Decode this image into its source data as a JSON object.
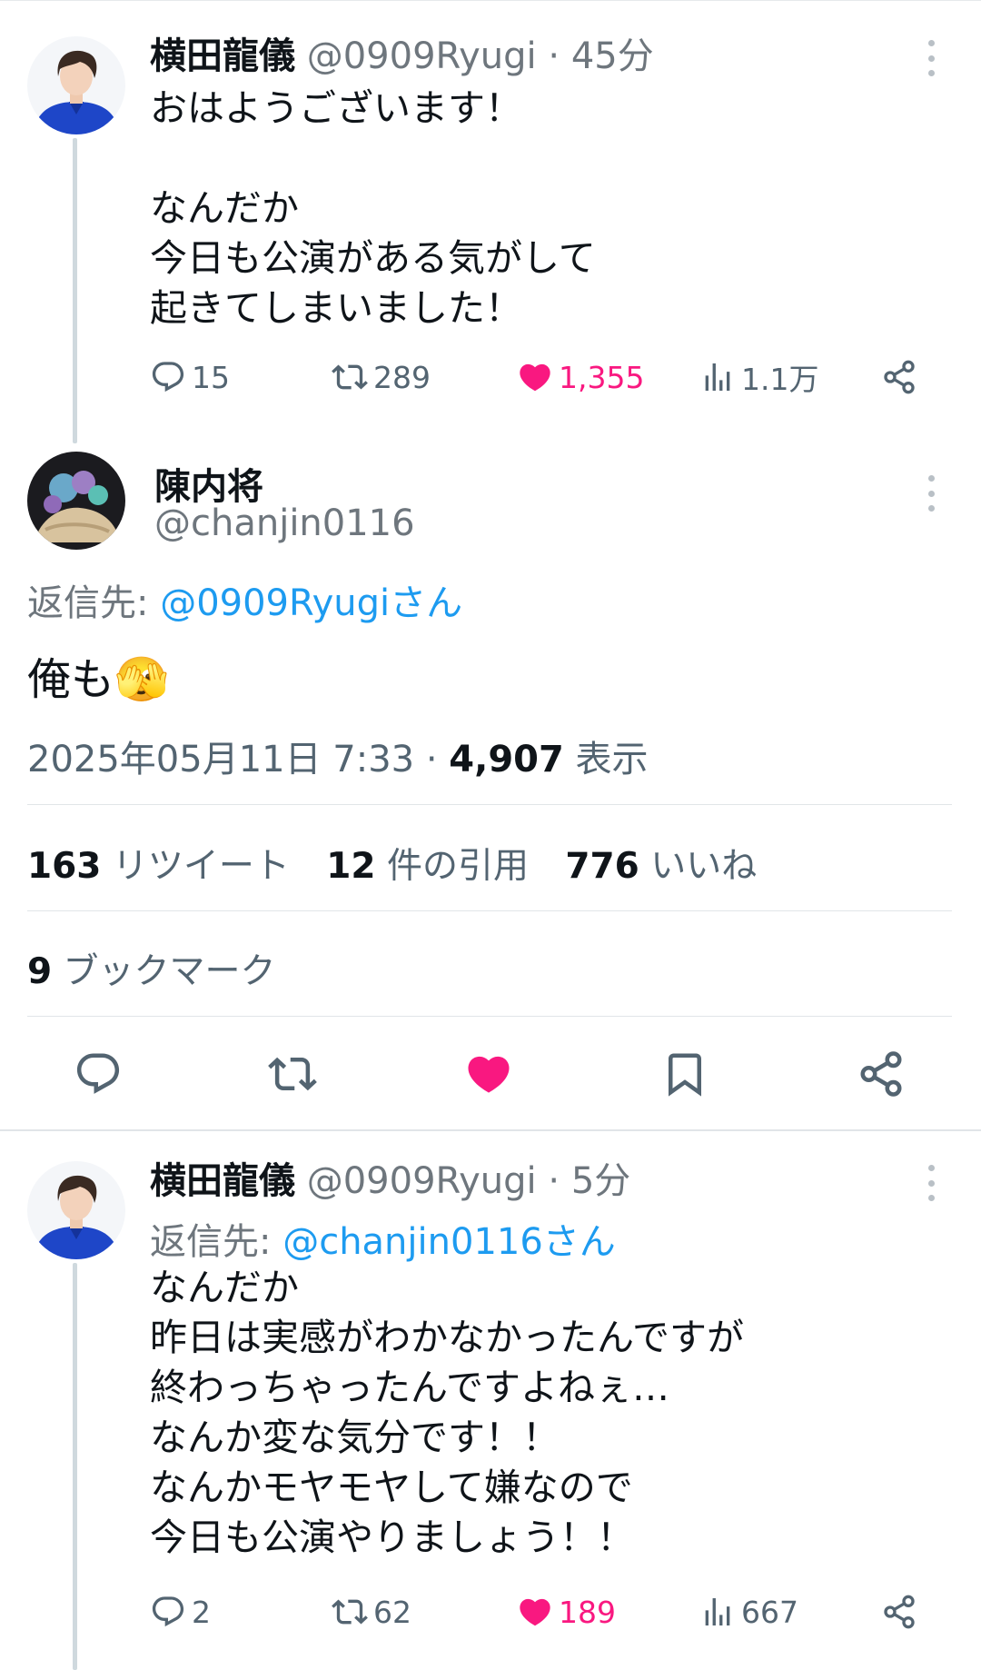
{
  "tweets": [
    {
      "name": "横田龍儀",
      "handle": "@0909Ryugi",
      "time": "45分",
      "lines": [
        "おはようございます！",
        "",
        "なんだか",
        "今日も公演がある気がして",
        "起きてしまいました！"
      ],
      "replies": "15",
      "retweets": "289",
      "likes": "1,355",
      "views": "1.1万"
    },
    {
      "name": "横田龍儀",
      "handle": "@0909Ryugi",
      "time": "5分",
      "reply_to_label": "返信先:",
      "reply_to_user": "@chanjin0116さん",
      "lines": [
        "なんだか",
        "昨日は実感がわかなかったんですが",
        "終わっちゃったんですよねぇ…",
        "なんか変な気分です！！",
        "なんかモヤモヤして嫌なので",
        "今日も公演やりましょう！！"
      ],
      "replies": "2",
      "retweets": "62",
      "likes": "189",
      "views": "667"
    }
  ],
  "main": {
    "name": "陳内将",
    "handle": "@chanjin0116",
    "reply_to_label": "返信先:",
    "reply_to_user": "@0909Ryugiさん",
    "text": "俺も",
    "emoji": "🫣",
    "date": "2025年05月11日 7:33",
    "views_count": "4,907",
    "views_label": "表示",
    "retweets_count": "163",
    "retweets_label": "リツイート",
    "quotes_count": "12",
    "quotes_label": "件の引用",
    "likes_count": "776",
    "likes_label": "いいね",
    "bookmarks_count": "9",
    "bookmarks_label": "ブックマーク"
  },
  "colors": {
    "like": "#f91880",
    "link": "#1d9bf0",
    "muted": "#536471"
  }
}
